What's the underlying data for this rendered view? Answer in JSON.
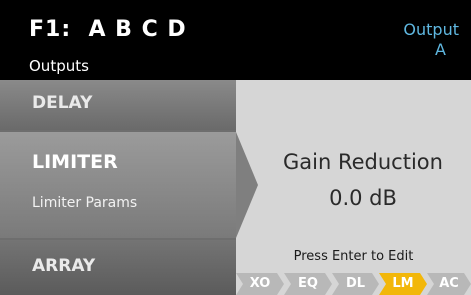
{
  "header": {
    "title": "F1:  A B C D",
    "subtitle": "Outputs",
    "output_label": "Output",
    "output_value": "A"
  },
  "menu": {
    "delay": "DELAY",
    "limiter": "LIMITER",
    "limiter_sub": "Limiter Params",
    "array": "ARRAY"
  },
  "main": {
    "label": "Gain Reduction",
    "value": "0.0 dB",
    "hint": "Press Enter to Edit"
  },
  "tabs": [
    {
      "label": "XO",
      "active": false
    },
    {
      "label": "EQ",
      "active": false
    },
    {
      "label": "DL",
      "active": false
    },
    {
      "label": "LM",
      "active": true
    },
    {
      "label": "AC",
      "active": false
    }
  ],
  "colors": {
    "accent": "#f2b70a",
    "output_text": "#5fb7e0"
  }
}
